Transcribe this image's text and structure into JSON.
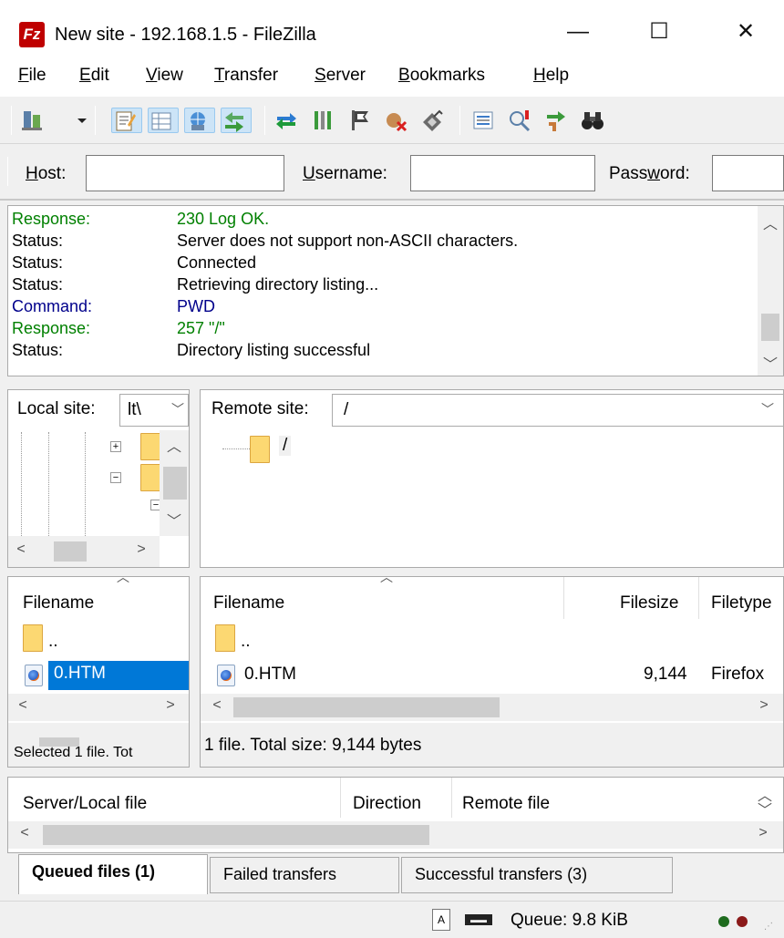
{
  "window": {
    "title": "New site - 192.168.1.5 - FileZilla",
    "app_icon": "filezilla-icon",
    "app_icon_glyph": "Fz",
    "minimize": "—",
    "maximize": "☐",
    "close": "✕"
  },
  "menu": [
    {
      "label": "File",
      "accel": "F",
      "rest": "ile"
    },
    {
      "label": "Edit",
      "accel": "E",
      "rest": "dit"
    },
    {
      "label": "View",
      "accel": "V",
      "rest": "iew"
    },
    {
      "label": "Transfer",
      "accel": "T",
      "rest": "ransfer"
    },
    {
      "label": "Server",
      "accel": "S",
      "rest": "erver"
    },
    {
      "label": "Bookmarks",
      "accel": "B",
      "rest": "ookmarks"
    },
    {
      "label": "Help",
      "accel": "H",
      "rest": "elp"
    }
  ],
  "quickconnect": {
    "host_label_accel": "H",
    "host_label_rest": "ost:",
    "username_label_accel": "U",
    "username_label_rest": "sername:",
    "password_label_pre": "Pass",
    "password_label_accel": "w",
    "password_label_rest": "ord:",
    "host_value": "",
    "username_value": "",
    "password_value": ""
  },
  "log": [
    {
      "type": "Response:",
      "msg": "230 Log OK.",
      "color": "#008000"
    },
    {
      "type": "Status:",
      "msg": "Server does not support non-ASCII characters.",
      "color": "#000000"
    },
    {
      "type": "Status:",
      "msg": "Connected",
      "color": "#000000"
    },
    {
      "type": "Status:",
      "msg": "Retrieving directory listing...",
      "color": "#000000"
    },
    {
      "type": "Command:",
      "msg": "PWD",
      "color": "#00008b"
    },
    {
      "type": "Response:",
      "msg": "257 \"/\"",
      "color": "#008000"
    },
    {
      "type": "Status:",
      "msg": "Directory listing successful",
      "color": "#000000"
    }
  ],
  "local": {
    "site_label": "Local site:",
    "site_value": "lt\\",
    "columns": {
      "filename": "Filename"
    },
    "files": [
      {
        "name": ".."
      },
      {
        "name": "0.HTM"
      }
    ],
    "status": "Selected 1 file. Tot"
  },
  "remote": {
    "site_label": "Remote site:",
    "site_value": "/",
    "tree_root": "/",
    "columns": {
      "filename": "Filename",
      "filesize": "Filesize",
      "filetype": "Filetype"
    },
    "files": [
      {
        "name": "..",
        "size": "",
        "type": ""
      },
      {
        "name": "0.HTM",
        "size": "9,144",
        "type": "Firefox"
      }
    ],
    "status": "1 file. Total size: 9,144 bytes"
  },
  "queue": {
    "columns": {
      "server_local": "Server/Local file",
      "direction": "Direction",
      "remote": "Remote file"
    }
  },
  "tabs": [
    {
      "label": "Queued files (1)",
      "active": true
    },
    {
      "label": "Failed transfers",
      "active": false
    },
    {
      "label": "Successful transfers (3)",
      "active": false
    }
  ],
  "statusbar": {
    "queue": "Queue: 9.8 KiB",
    "led_colors": [
      "#1e6b1e",
      "#8b1a1a"
    ]
  }
}
